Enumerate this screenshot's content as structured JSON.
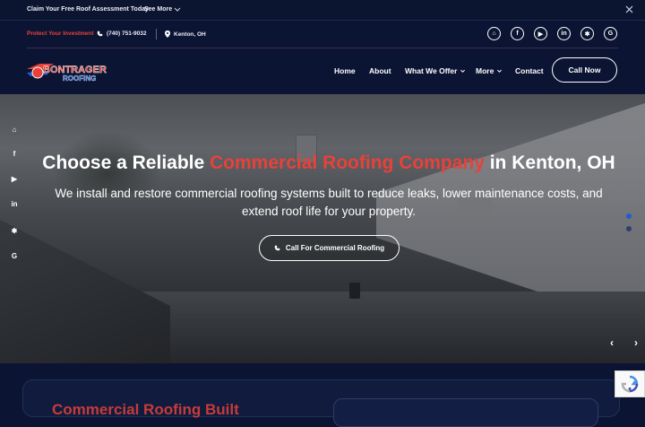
{
  "topbar": {
    "claim": "Claim Your Free Roof Assessment Today",
    "see_more": "See More"
  },
  "utility": {
    "tagline": "Protect Your Investment",
    "phone": "(740) 751-9032",
    "location": "Kenton, OH"
  },
  "social": [
    {
      "name": "nextdoor-icon",
      "glyph": "⌂"
    },
    {
      "name": "facebook-icon",
      "glyph": "f"
    },
    {
      "name": "youtube-icon",
      "glyph": "▶"
    },
    {
      "name": "linkedin-icon",
      "glyph": "in"
    },
    {
      "name": "yelp-icon",
      "glyph": "✱"
    },
    {
      "name": "google-icon",
      "glyph": "G"
    }
  ],
  "logo": {
    "line1": "BONTRAGER",
    "line2": "ROOFING"
  },
  "nav": {
    "home": "Home",
    "about": "About",
    "what_we_offer": "What We Offer",
    "more": "More",
    "contact": "Contact",
    "cta": "Call Now"
  },
  "hero": {
    "title_pre": "Choose a Reliable ",
    "title_accent": "Commercial Roofing Company",
    "title_post": " in Kenton, OH",
    "subtitle": "We install and restore commercial roofing systems built to reduce leaks, lower maintenance costs, and extend roof life for your property.",
    "button": "Call For Commercial Roofing"
  },
  "section": {
    "title_partial": "Commercial Roofing Built"
  },
  "colors": {
    "accent": "#e8413a",
    "navy": "#0b1533",
    "dot_active": "#1f5bd6",
    "dot_inactive": "#2d3f6e"
  }
}
